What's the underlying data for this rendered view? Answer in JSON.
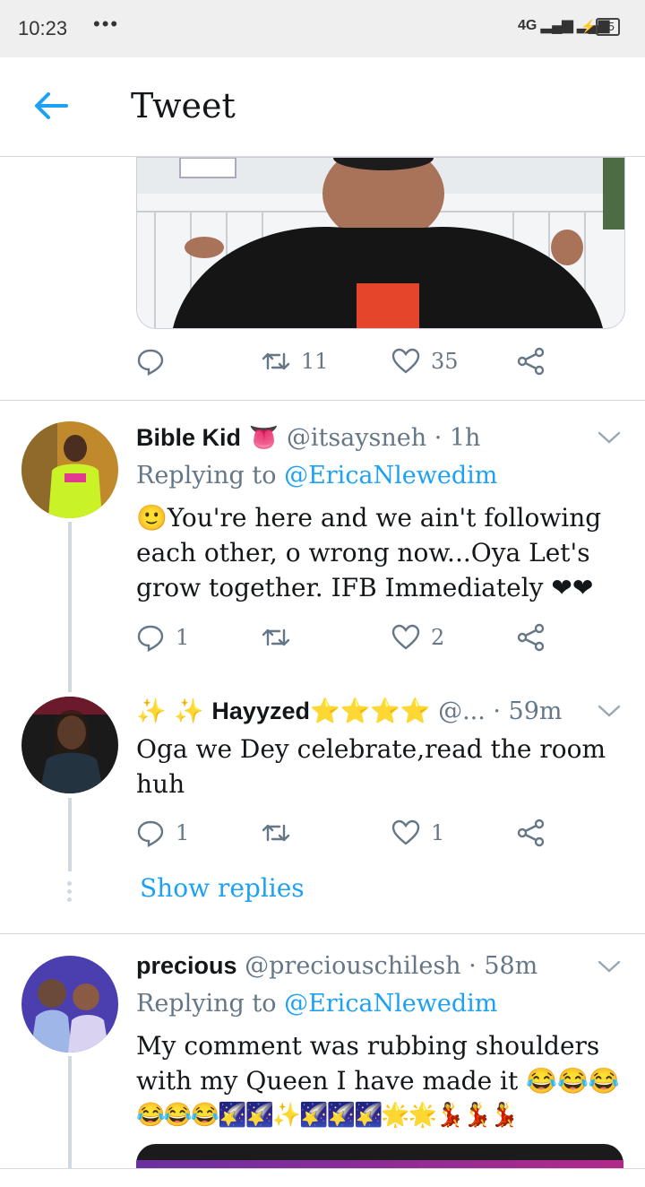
{
  "status_bar": {
    "time": "10:23",
    "dots": "•••",
    "network": "4G",
    "battery": "55"
  },
  "header": {
    "title": "Tweet",
    "back_icon": "arrow-left-icon"
  },
  "main_tweet_actions": {
    "retweets": "11",
    "likes": "35"
  },
  "replies": [
    {
      "name": "Bible Kid",
      "name_emoji": "👅",
      "meta": "@itsaysneh · 1h",
      "replying_prefix": "Replying to ",
      "replying_to": "@EricaNlewedim",
      "body": "🙂You're here and we ain't following each other, o wrong now...Oya Let's grow together. IFB  Immediately ❤❤",
      "reply_count": "1",
      "retweet_count": "",
      "like_count": "2"
    },
    {
      "name_prefix": "✨ ✨",
      "name": "Hayyzed",
      "name_suffix": "⭐⭐⭐⭐",
      "meta": "@... · 59m",
      "body": "Oga we Dey celebrate,read the room huh",
      "reply_count": "1",
      "retweet_count": "",
      "like_count": "1",
      "show_replies": "Show replies"
    },
    {
      "name": "precious",
      "meta": "@preciouschilesh · 58m",
      "replying_prefix": "Replying to ",
      "replying_to": "@EricaNlewedim",
      "body_line1": "My comment was rubbing shoulders",
      "body_line2": "with my Queen I have made it 😂😂😂",
      "body_line3": "😂😂😂🌠🌠✨🌠🌠🌠🌟🌟💃💃💃"
    }
  ],
  "colors": {
    "accent": "#1da1f2",
    "heart": "#e0245e",
    "meta": "#657786"
  }
}
